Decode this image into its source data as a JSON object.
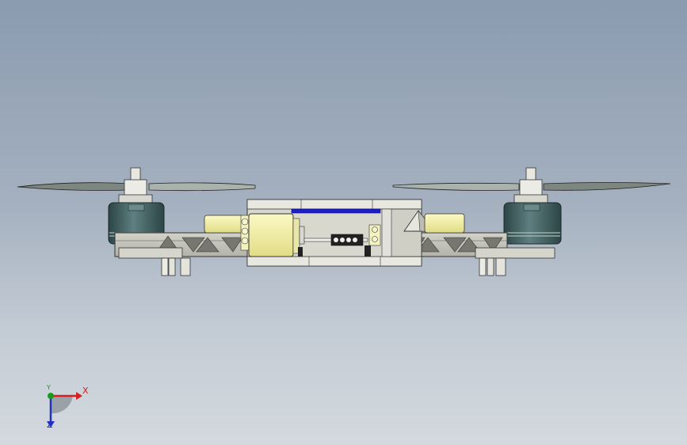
{
  "viewport": {
    "background_top": "#8b9bb0",
    "background_bottom": "#d3d9de"
  },
  "model": {
    "frame_color": "#c8c8bd",
    "motor_color": "#3f5f60",
    "esc_color": "#f2f0a4",
    "wire_color": "#1e1ec8",
    "propeller_color": "#9aa39c"
  },
  "triad": {
    "x_label": "X",
    "y_label": "Y",
    "z_label": "Z",
    "x_color": "#d42020",
    "y_color": "#1a9a1a",
    "z_color": "#2030c0"
  }
}
